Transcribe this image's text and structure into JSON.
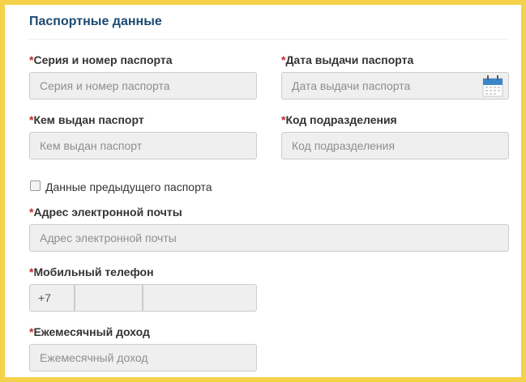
{
  "section": {
    "title": "Паспортные данные"
  },
  "required_mark": "*",
  "passport_number": {
    "label": "Серия и номер паспорта",
    "placeholder": "Серия и номер паспорта"
  },
  "issue_date": {
    "label": "Дата выдачи паспорта",
    "placeholder": "Дата выдачи паспорта",
    "icon": "calendar-icon"
  },
  "issued_by": {
    "label": "Кем выдан паспорт",
    "placeholder": "Кем выдан паспорт"
  },
  "division_code": {
    "label": "Код подразделения",
    "placeholder": "Код подразделения"
  },
  "previous_passport": {
    "label": "Данные предыдущего паспорта",
    "checked": false
  },
  "email": {
    "label": "Адрес электронной почты",
    "placeholder": "Адрес электронной почты"
  },
  "phone": {
    "label": "Мобильный телефон",
    "prefix": "+7"
  },
  "income": {
    "label": "Ежемесячный доход",
    "placeholder": "Ежемесячный доход"
  },
  "colors": {
    "frame": "#f5d24a",
    "title": "#1c4a74",
    "required": "#c0282d",
    "input_bg": "#efefef"
  }
}
